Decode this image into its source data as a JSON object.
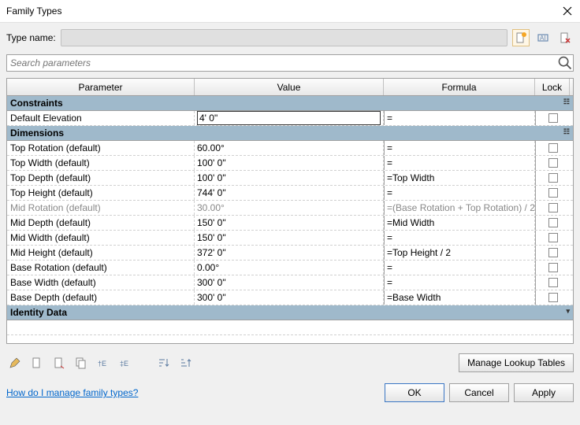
{
  "window": {
    "title": "Family Types"
  },
  "typename": {
    "label": "Type name:",
    "value": ""
  },
  "search": {
    "placeholder": "Search parameters"
  },
  "columns": {
    "param": "Parameter",
    "value": "Value",
    "formula": "Formula",
    "lock": "Lock"
  },
  "groups": [
    {
      "name": "Constraints",
      "expanded": true,
      "rows": [
        {
          "param": "Default Elevation",
          "value": "4'  0\"",
          "formula": "=",
          "editable": true
        }
      ]
    },
    {
      "name": "Dimensions",
      "expanded": true,
      "rows": [
        {
          "param": "Top Rotation (default)",
          "value": "60.00°",
          "formula": "="
        },
        {
          "param": "Top Width (default)",
          "value": "100'  0\"",
          "formula": "="
        },
        {
          "param": "Top Depth (default)",
          "value": "100'  0\"",
          "formula": "=Top Width"
        },
        {
          "param": "Top Height (default)",
          "value": "744'  0\"",
          "formula": "="
        },
        {
          "param": "Mid Rotation (default)",
          "value": "30.00°",
          "formula": "=(Base Rotation + Top Rotation) / 2",
          "muted": true
        },
        {
          "param": "Mid Depth (default)",
          "value": "150'  0\"",
          "formula": "=Mid Width"
        },
        {
          "param": "Mid Width (default)",
          "value": "150'  0\"",
          "formula": "="
        },
        {
          "param": "Mid Height (default)",
          "value": "372'  0\"",
          "formula": "=Top Height / 2"
        },
        {
          "param": "Base Rotation (default)",
          "value": "0.00°",
          "formula": "="
        },
        {
          "param": "Base Width (default)",
          "value": "300'  0\"",
          "formula": "="
        },
        {
          "param": "Base Depth (default)",
          "value": "300'  0\"",
          "formula": "=Base Width"
        }
      ]
    },
    {
      "name": "Identity Data",
      "expanded": false,
      "rows": []
    }
  ],
  "toolbar": {
    "manage": "Manage Lookup Tables"
  },
  "footer": {
    "help": "How do I manage family types?",
    "ok": "OK",
    "cancel": "Cancel",
    "apply": "Apply"
  }
}
